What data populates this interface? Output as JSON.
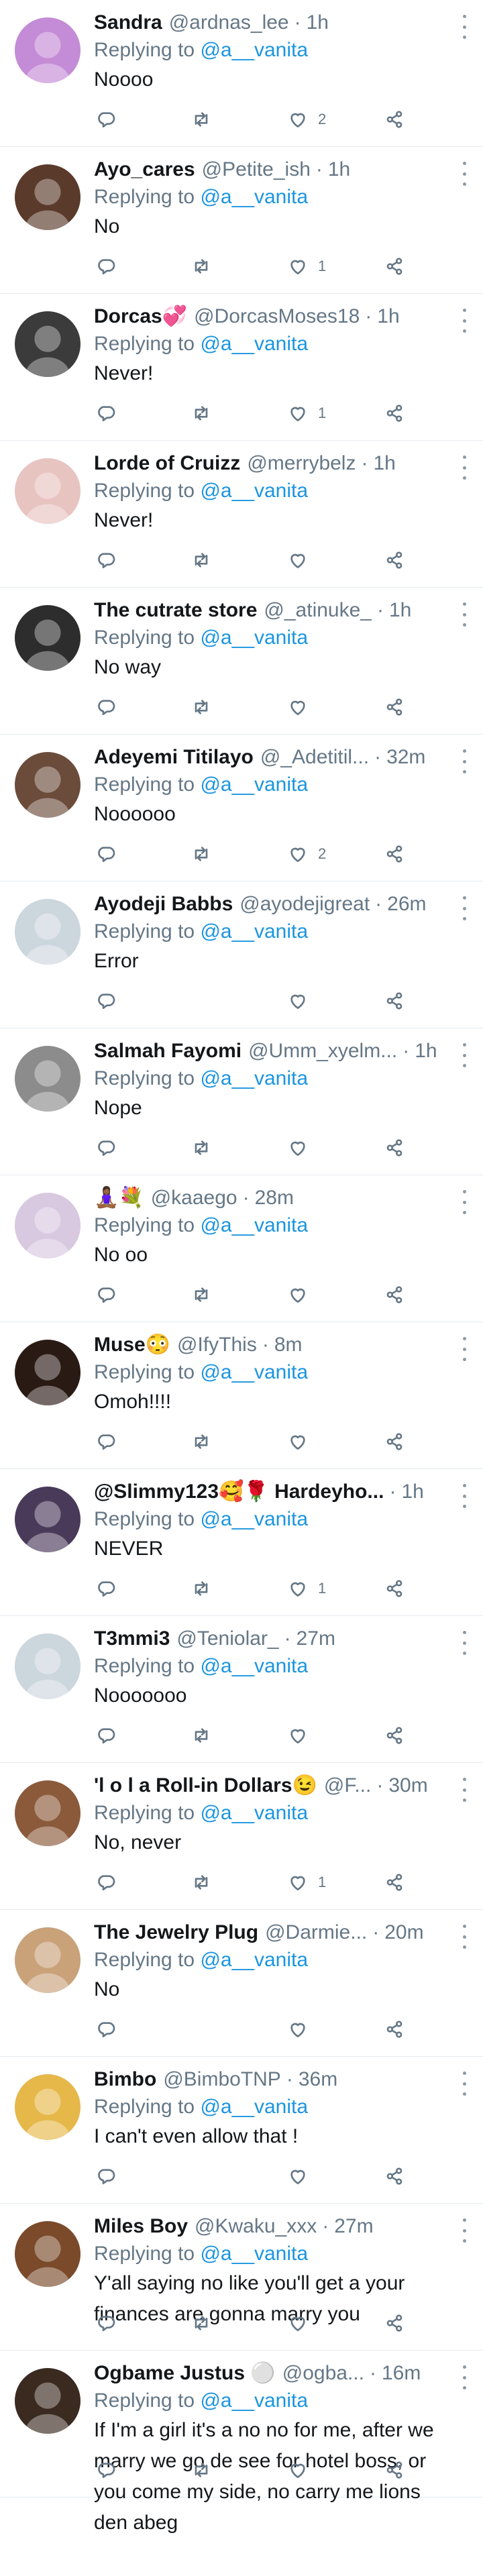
{
  "reply_prefix": "Replying to",
  "reply_mention": "@a__vanita",
  "tweets": [
    {
      "name": "Sandra",
      "handle": "@ardnas_lee",
      "time": "1h",
      "text": "Noooo",
      "likes": "2",
      "avatar_color": "#c48bd6",
      "retweet": true
    },
    {
      "name": "Ayo_cares",
      "handle": "@Petite_ish",
      "time": "1h",
      "text": "No",
      "likes": "1",
      "avatar_color": "#5a3a2a",
      "retweet": true
    },
    {
      "name": "Dorcas💞",
      "handle": "@DorcasMoses18",
      "time": "1h",
      "text": "Never!",
      "likes": "1",
      "avatar_color": "#3b3b3b",
      "retweet": true
    },
    {
      "name": "Lorde of Cruizz",
      "handle": "@merrybelz",
      "time": "1h",
      "text": "Never!",
      "likes": "",
      "avatar_color": "#e8c4c0",
      "retweet": true
    },
    {
      "name": "The cutrate store",
      "handle": "@_atinuke_",
      "time": "1h",
      "text": "No way",
      "likes": "",
      "avatar_color": "#2d2d2d",
      "retweet": true
    },
    {
      "name": "Adeyemi Titilayo",
      "handle": "@_Adetitil...",
      "time": "32m",
      "text": "Noooooo",
      "likes": "2",
      "avatar_color": "#6b4c3b",
      "retweet": true
    },
    {
      "name": "Ayodeji Babbs",
      "handle": "@ayodejigreat",
      "time": "26m",
      "text": "Error",
      "likes": "",
      "avatar_color": "#ccd6dd",
      "retweet": false
    },
    {
      "name": "Salmah Fayomi",
      "handle": "@Umm_xyelm...",
      "time": "1h",
      "text": "Nope",
      "likes": "",
      "avatar_color": "#8c8c8c",
      "retweet": true
    },
    {
      "name": "🧘🏾‍♀️💐",
      "handle": "@kaaego",
      "time": "28m",
      "text": "No oo",
      "likes": "",
      "avatar_color": "#d8c8e0",
      "retweet": true
    },
    {
      "name": "Muse😳",
      "handle": "@IfyThis",
      "time": "8m",
      "text": "Omoh!!!!",
      "likes": "",
      "avatar_color": "#2a1a14",
      "retweet": true
    },
    {
      "name": "@Slimmy123🥰🌹 Hardeyho...",
      "handle": "",
      "time": "1h",
      "text": "NEVER",
      "likes": "1",
      "avatar_color": "#4a3a5a",
      "retweet": true
    },
    {
      "name": "T3mmi3",
      "handle": "@Teniolar_",
      "time": "27m",
      "text": "Nooooooo",
      "likes": "",
      "avatar_color": "#ccd6dd",
      "retweet": true
    },
    {
      "name": "'l o l a Roll-in Dollars😉",
      "handle": "@F...",
      "time": "30m",
      "text": "No, never",
      "likes": "1",
      "avatar_color": "#8a5a3a",
      "retweet": true
    },
    {
      "name": "The Jewelry Plug",
      "handle": "@Darmie...",
      "time": "20m",
      "text": "No",
      "likes": "",
      "avatar_color": "#c9a27a",
      "retweet": false
    },
    {
      "name": "Bimbo",
      "handle": "@BimboTNP",
      "time": "36m",
      "text": "I can't even allow that !",
      "likes": "",
      "avatar_color": "#e6b84a",
      "retweet": false
    },
    {
      "name": "Miles Boy",
      "handle": "@Kwaku_xxx",
      "time": "27m",
      "text": "Y'all saying no like you'll get a your finances are gonna marry you",
      "likes": "",
      "avatar_color": "#7a4a2a",
      "retweet": true
    },
    {
      "name": "Ogbame Justus ⚪",
      "handle": "@ogba...",
      "time": "16m",
      "text": "If I'm a girl it's a no no for me, after we marry we go de see for hotel boss, or you come my side, no carry me lions den abeg",
      "likes": "",
      "avatar_color": "#3a2a20",
      "retweet": true
    }
  ]
}
